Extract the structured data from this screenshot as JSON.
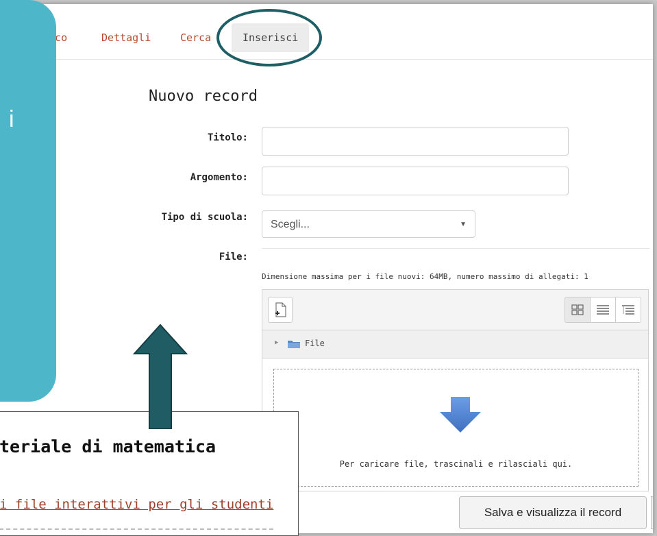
{
  "tabs": [
    {
      "label": "enco",
      "active": false
    },
    {
      "label": "Dettagli",
      "active": false
    },
    {
      "label": "Cerca",
      "active": false
    },
    {
      "label": "Inserisci",
      "active": true
    }
  ],
  "form": {
    "title": "Nuovo record",
    "fields": [
      {
        "label": "Titolo:",
        "value": ""
      },
      {
        "label": "Argomento:",
        "value": ""
      },
      {
        "label": "Tipo di scuola:",
        "value": "Scegli..."
      },
      {
        "label": "File:"
      }
    ]
  },
  "filepicker": {
    "limits": "Dimensione massima per i file nuovi: 64MB, numero massimo di allegati: 1",
    "path_folder": "File",
    "drop_text": "Per caricare file, trascinali e rilasciali qui.",
    "view_icons": [
      "grid-view-icon",
      "list-view-icon",
      "tree-view-icon"
    ]
  },
  "actions": {
    "save_label": "Salva e visualizza il record"
  },
  "overlay": {
    "teal_char": "i",
    "callout_title": "teriale di matematica",
    "callout_link": "i file interattivi per gli studenti"
  },
  "colors": {
    "teal": "#4db6c8",
    "ring": "#1e5f66",
    "arrow": "#1f5c64",
    "link": "#a0402a",
    "tab_text": "#b84a2e"
  }
}
